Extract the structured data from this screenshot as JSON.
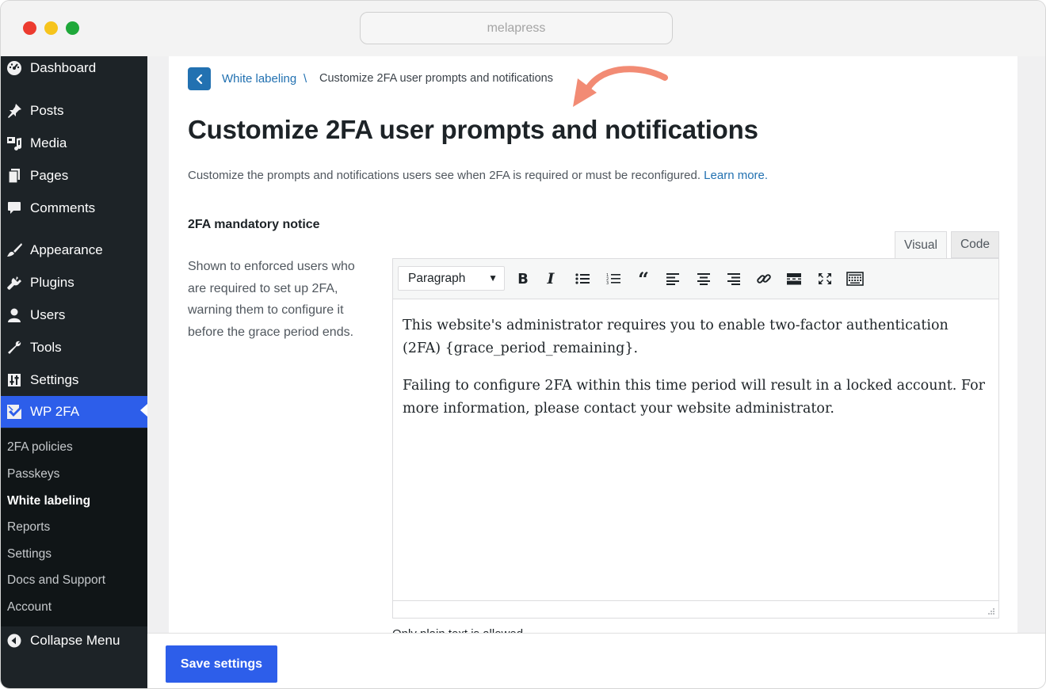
{
  "window": {
    "address": "melapress"
  },
  "sidebar": {
    "items": [
      {
        "label": "Dashboard",
        "icon": "dashboard-icon"
      },
      {
        "label": "Posts",
        "icon": "pin-icon"
      },
      {
        "label": "Media",
        "icon": "media-icon"
      },
      {
        "label": "Pages",
        "icon": "pages-icon"
      },
      {
        "label": "Comments",
        "icon": "comment-icon"
      },
      {
        "label": "Appearance",
        "icon": "brush-icon"
      },
      {
        "label": "Plugins",
        "icon": "plugin-icon"
      },
      {
        "label": "Users",
        "icon": "user-icon"
      },
      {
        "label": "Tools",
        "icon": "wrench-icon"
      },
      {
        "label": "Settings",
        "icon": "sliders-icon"
      },
      {
        "label": "WP 2FA",
        "icon": "wp2fa-icon",
        "active": true
      }
    ],
    "submenu": [
      {
        "label": "2FA policies"
      },
      {
        "label": "Passkeys"
      },
      {
        "label": "White labeling",
        "current": true
      },
      {
        "label": "Reports"
      },
      {
        "label": "Settings"
      },
      {
        "label": "Docs and Support"
      },
      {
        "label": "Account"
      }
    ],
    "collapse_label": "Collapse Menu"
  },
  "breadcrumb": {
    "parent": "White labeling",
    "separator": "\\",
    "current": "Customize 2FA user prompts and notifications"
  },
  "page": {
    "title": "Customize 2FA user prompts and notifications",
    "description": "Customize the prompts and notifications users see when 2FA is required or must be reconfigured.",
    "learn_more": "Learn more."
  },
  "section": {
    "label": "2FA mandatory notice",
    "help": "Shown to enforced users who are required to set up 2FA, warning them to configure it before the grace period ends."
  },
  "editor": {
    "tabs": {
      "visual": "Visual",
      "code": "Code"
    },
    "format": "Paragraph",
    "toolbar": [
      "bold-icon",
      "italic-icon",
      "bullet-list-icon",
      "numbered-list-icon",
      "blockquote-icon",
      "align-left-icon",
      "align-center-icon",
      "align-right-icon",
      "link-icon",
      "read-more-icon",
      "fullscreen-icon",
      "toolbar-toggle-icon"
    ],
    "paragraphs": [
      "This website's administrator requires you to enable two-factor authentication (2FA) {grace_period_remaining}.",
      "Failing to configure 2FA within this time period will result in a locked account. For more information, please contact your website administrator."
    ],
    "below_text": "Only plain text is allowed."
  },
  "footer": {
    "save_label": "Save settings"
  },
  "colors": {
    "accent": "#2d5eea",
    "link": "#2271b1",
    "sidebar": "#1d2327",
    "arrow": "#f28b74"
  }
}
